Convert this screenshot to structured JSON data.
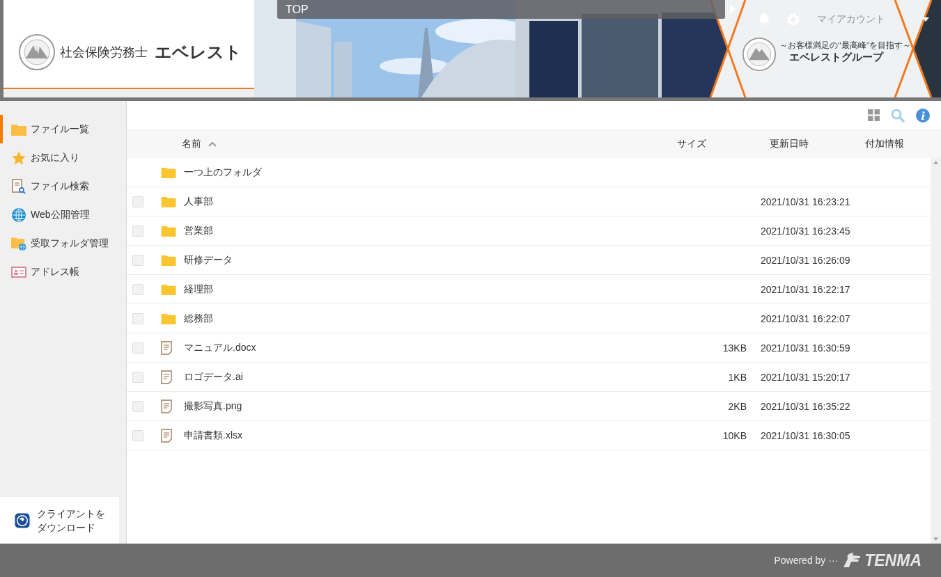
{
  "header": {
    "breadcrumb": "TOP",
    "company_prefix": "社会保険労務士",
    "company_name": "エベレスト",
    "account": "マイアカウント",
    "tagline": "～お客様満足の\"最高峰\"を目指す～",
    "group_name": "エベレストグループ"
  },
  "sidebar": {
    "items": [
      {
        "label": "ファイル一覧",
        "selected": true
      },
      {
        "label": "お気に入り",
        "selected": false
      },
      {
        "label": "ファイル検索",
        "selected": false
      },
      {
        "label": "Web公開管理",
        "selected": false
      },
      {
        "label": "受取フォルダ管理",
        "selected": false
      },
      {
        "label": "アドレス帳",
        "selected": false
      }
    ],
    "download_lines": [
      "クライアントを",
      "ダウンロード"
    ]
  },
  "table": {
    "columns": [
      {
        "label": "名前"
      },
      {
        "label": "サイズ"
      },
      {
        "label": "更新日時"
      },
      {
        "label": "付加情報"
      }
    ],
    "rows": [
      {
        "kind": "parent",
        "name": "一つ上のフォルダ"
      },
      {
        "kind": "folder",
        "name": "人事部",
        "checked": false,
        "modified": "2021/10/31 16:23:21"
      },
      {
        "kind": "folder",
        "name": "営業部",
        "checked": false,
        "modified": "2021/10/31 16:23:45"
      },
      {
        "kind": "folder",
        "name": "研修データ",
        "checked": false,
        "modified": "2021/10/31 16:26:09"
      },
      {
        "kind": "folder",
        "name": "経理部",
        "checked": false,
        "modified": "2021/10/31 16:22:17"
      },
      {
        "kind": "folder",
        "name": "総務部",
        "checked": false,
        "modified": "2021/10/31 16:22:07"
      },
      {
        "kind": "file",
        "name": "マニュアル.docx",
        "checked": false,
        "size": "13KB",
        "modified": "2021/10/31 16:30:59"
      },
      {
        "kind": "file",
        "name": "ロゴデータ.ai",
        "checked": false,
        "size": "1KB",
        "modified": "2021/10/31 15:20:17"
      },
      {
        "kind": "file",
        "name": "撮影写真.png",
        "checked": false,
        "size": "2KB",
        "modified": "2021/10/31 16:35:22"
      },
      {
        "kind": "file",
        "name": "申請書類.xlsx",
        "checked": false,
        "size": "10KB",
        "modified": "2021/10/31 16:30:05"
      }
    ]
  },
  "footer": {
    "powered_by": "Powered by ···",
    "brand": "TENMA"
  }
}
